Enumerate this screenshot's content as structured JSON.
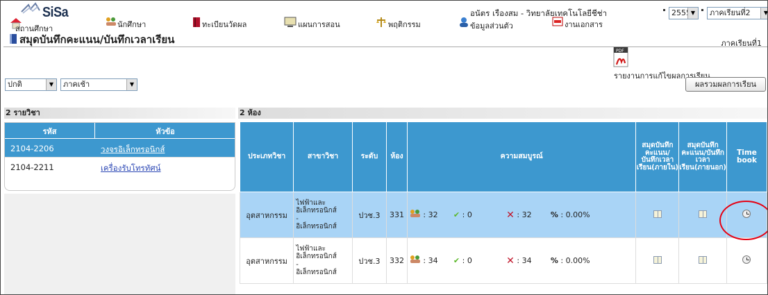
{
  "app": {
    "logo": "SiSa",
    "user_line": "อนัตร เรืองสม - วิทยาลัยเทคโนโลยีชีช่า",
    "year": "2555",
    "term_select": "ภาคเรียนที่2"
  },
  "menu": [
    {
      "label": "สถานศึกษา",
      "icon": "school-icon"
    },
    {
      "label": "นักศึกษา",
      "icon": "students-icon"
    },
    {
      "label": "ทะเบียนวัดผล",
      "icon": "book-icon"
    },
    {
      "label": "แผนการสอน",
      "icon": "monitor-icon"
    },
    {
      "label": "พฤติกรรม",
      "icon": "scale-icon"
    },
    {
      "label": "ข้อมูลส่วนตัว",
      "icon": "person-icon"
    },
    {
      "label": "งานเอกสาร",
      "icon": "document-icon"
    }
  ],
  "page": {
    "title": "สมุดบันทึกคะแนน/บันทึกเวลาเรียน",
    "term_right": "ภาคเรียนที่1"
  },
  "filters": {
    "level": "ปกติ",
    "session": "ภาคเช้า"
  },
  "actions": {
    "pdf_report": "รายงานการแก้ไขผลการเรียน",
    "summary_button": "ผลรวมผลการเรียน"
  },
  "subjects": {
    "header": "2 รายวิชา",
    "columns": [
      "รหัส",
      "หัวข้อ"
    ],
    "rows": [
      {
        "code": "2104-2206",
        "name": "วงจรอิเล็กทรอนิกส์"
      },
      {
        "code": "2104-2211",
        "name": "เครื่องรับโทรทัศน์"
      }
    ]
  },
  "rooms": {
    "header": "2 ห้อง",
    "columns": {
      "type": "ประเภทวิชา",
      "branch": "สาขาวิชา",
      "level": "ระดับ",
      "room": "ห้อง",
      "completeness": "ความสมบูรณ์",
      "book_in": "สมุดบันทึกคะแนน/บันทึกเวลาเรียน(ภายใน)",
      "book_out": "สมุดบันทึกคะแนน/บันทึกเวลาเรียน(ภายนอก)",
      "time": "Time book"
    },
    "rows": [
      {
        "type": "อุตสาหกรรม",
        "branch1": "ไฟฟ้าและ",
        "branch2": "อิเล็กทรอนิกส์",
        "branch3": "-",
        "branch4": "อิเล็กทรอนิกส์",
        "level": "ปวช.3",
        "room": "331",
        "students": ": 32",
        "done": ": 0",
        "missing": ": 32",
        "pct": ": 0.00%"
      },
      {
        "type": "อุตสาหกรรม",
        "branch1": "ไฟฟ้าและ",
        "branch2": "อิเล็กทรอนิกส์",
        "branch3": "-",
        "branch4": "อิเล็กทรอนิกส์",
        "level": "ปวช.3",
        "room": "332",
        "students": ": 34",
        "done": ": 0",
        "missing": ": 34",
        "pct": ": 0.00%"
      }
    ]
  },
  "symbols": {
    "percent": "%",
    "cross": "✕",
    "check": "✔"
  },
  "colors": {
    "header_blue": "#3d98cf",
    "row_highlight": "#a9d4f6",
    "highlight_circle": "#e60012"
  }
}
